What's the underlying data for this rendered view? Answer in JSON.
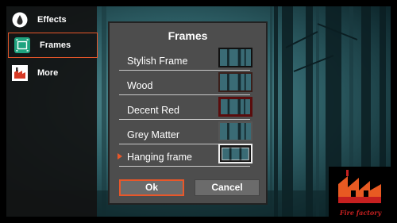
{
  "sidebar": {
    "items": [
      {
        "label": "Effects",
        "icon": "drop-icon"
      },
      {
        "label": "Frames",
        "icon": "frame-icon"
      },
      {
        "label": "More",
        "icon": "factory-icon"
      }
    ],
    "active": "Frames"
  },
  "dialog": {
    "title": "Frames",
    "options": [
      {
        "label": "Stylish Frame",
        "selected": false
      },
      {
        "label": "Wood",
        "selected": false
      },
      {
        "label": "Decent Red",
        "selected": false
      },
      {
        "label": "Grey Matter",
        "selected": false
      },
      {
        "label": "Hanging frame",
        "selected": true
      }
    ],
    "ok_label": "Ok",
    "cancel_label": "Cancel"
  },
  "logo": {
    "text": "Fire factory"
  },
  "colors": {
    "accent": "#e8572a",
    "dialog_bg": "#4d4d4d",
    "sidebar_bg": "#121212"
  }
}
